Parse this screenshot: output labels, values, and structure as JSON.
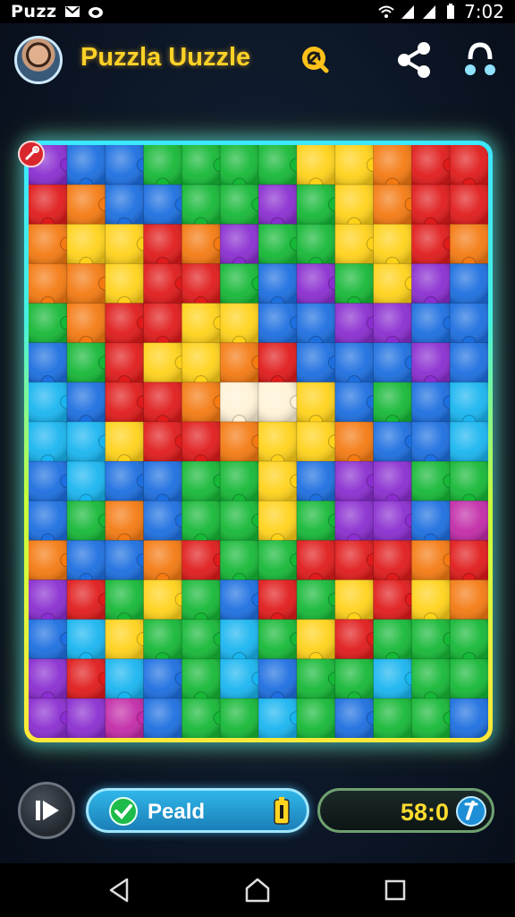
{
  "status_bar": {
    "left_text": "Puzz",
    "time": "7:02",
    "icons": [
      "gmail-icon",
      "cat-icon",
      "wifi-icon",
      "signal-icon",
      "signal-icon",
      "battery-icon"
    ]
  },
  "header": {
    "title": "Puzzla Uuzzle",
    "title_badge_icon": "magnifier-badge-icon",
    "avatar": "avatar",
    "actions": [
      "share-icon",
      "people-icon"
    ]
  },
  "board": {
    "rows": 15,
    "cols": 12,
    "corner_icon": "wrench-icon",
    "palette": {
      "red": "#e01b1b",
      "orange": "#f47a12",
      "yellow": "#ffd21a",
      "lime": "#7fd12a",
      "green": "#16b837",
      "teal": "#0ccf9a",
      "cyan": "#19b5f0",
      "blue": "#1d6fe0",
      "indigo": "#3a3fd6",
      "purple": "#8a2ed0",
      "magenta": "#c22ba8",
      "white": "#fff2d6"
    },
    "grid": [
      [
        "purple",
        "blue",
        "blue",
        "green",
        "green",
        "green",
        "green",
        "yellow",
        "yellow",
        "orange",
        "red",
        "red"
      ],
      [
        "red",
        "orange",
        "blue",
        "blue",
        "green",
        "green",
        "purple",
        "green",
        "yellow",
        "orange",
        "red",
        "red"
      ],
      [
        "orange",
        "yellow",
        "yellow",
        "red",
        "orange",
        "purple",
        "green",
        "green",
        "yellow",
        "yellow",
        "red",
        "orange"
      ],
      [
        "orange",
        "orange",
        "yellow",
        "red",
        "red",
        "green",
        "blue",
        "purple",
        "green",
        "yellow",
        "purple",
        "blue"
      ],
      [
        "green",
        "orange",
        "red",
        "red",
        "yellow",
        "yellow",
        "blue",
        "blue",
        "purple",
        "purple",
        "blue",
        "blue"
      ],
      [
        "blue",
        "green",
        "red",
        "yellow",
        "yellow",
        "orange",
        "red",
        "blue",
        "blue",
        "blue",
        "purple",
        "blue"
      ],
      [
        "cyan",
        "blue",
        "red",
        "red",
        "orange",
        "white",
        "white",
        "yellow",
        "blue",
        "green",
        "blue",
        "cyan"
      ],
      [
        "cyan",
        "cyan",
        "yellow",
        "red",
        "red",
        "orange",
        "yellow",
        "yellow",
        "orange",
        "blue",
        "blue",
        "cyan"
      ],
      [
        "blue",
        "cyan",
        "blue",
        "blue",
        "green",
        "green",
        "yellow",
        "blue",
        "purple",
        "purple",
        "green",
        "green"
      ],
      [
        "blue",
        "green",
        "orange",
        "blue",
        "green",
        "green",
        "yellow",
        "green",
        "purple",
        "purple",
        "blue",
        "magenta"
      ],
      [
        "orange",
        "blue",
        "blue",
        "orange",
        "red",
        "green",
        "green",
        "red",
        "red",
        "red",
        "orange",
        "red"
      ],
      [
        "purple",
        "red",
        "green",
        "yellow",
        "green",
        "blue",
        "red",
        "green",
        "yellow",
        "red",
        "yellow",
        "orange"
      ],
      [
        "blue",
        "cyan",
        "yellow",
        "green",
        "green",
        "cyan",
        "green",
        "yellow",
        "red",
        "green",
        "green",
        "green"
      ],
      [
        "purple",
        "red",
        "cyan",
        "blue",
        "green",
        "cyan",
        "blue",
        "green",
        "green",
        "cyan",
        "green",
        "green"
      ],
      [
        "purple",
        "purple",
        "magenta",
        "blue",
        "green",
        "green",
        "cyan",
        "green",
        "blue",
        "green",
        "green",
        "blue"
      ]
    ]
  },
  "controls": {
    "play_icon": "play-pause-icon",
    "status_label": "Peald",
    "status_icon": "check-icon",
    "status_right_icon": "battery-icon",
    "timer": "58:0",
    "timer_icon": "timer-icon"
  },
  "nav_bar": {
    "buttons": [
      "back-icon",
      "home-icon",
      "recents-icon"
    ]
  },
  "colors": {
    "title": "#ffd228",
    "frame_top": "#3be8ff",
    "frame_bottom": "#ffe83a",
    "status_pill": "#2fb6e8",
    "timer_text": "#ffdd2e"
  }
}
